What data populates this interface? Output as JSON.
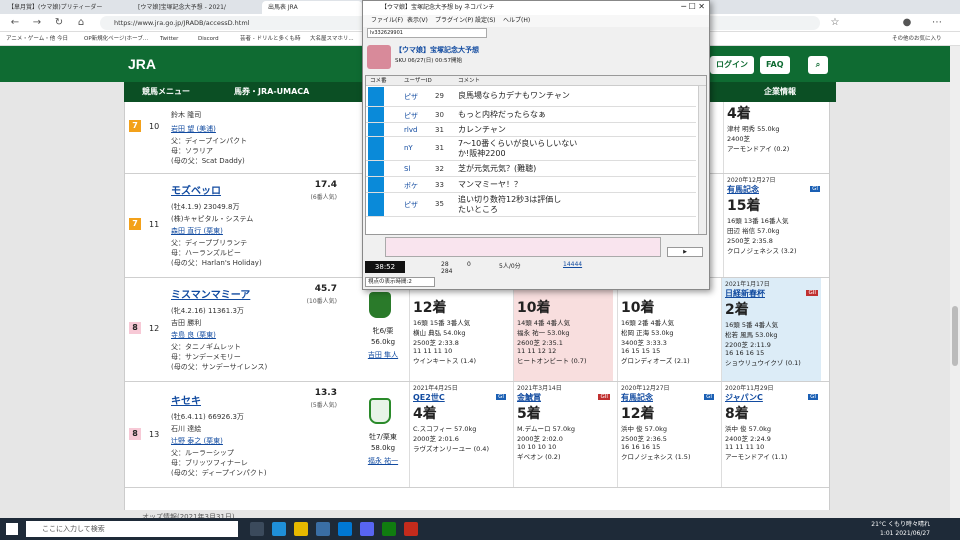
{
  "browser": {
    "tabs": [
      "【皐月賞】(ウマ娘)プリティーダー",
      "[ウマ娘]宝塚記念大予想 - 2021/",
      "出馬表 JRA"
    ],
    "url": "https://www.jra.go.jp/JRADB/accessD.html",
    "bookmarks": [
      "アニメ・ゲーム・他 今日",
      "OP新規化ページ(ホーブ...",
      "Twitter",
      "Discord",
      "芸者 - ドリルと多くも時",
      "大名屋スマホリ...",
      "その他のお気に入り"
    ]
  },
  "jra": {
    "logo": "JRA",
    "login_label": "ログイン",
    "faq_label": "FAQ",
    "nav": [
      "競馬メニュー",
      "馬券・JRA-UMACA",
      "企業情報"
    ]
  },
  "horses": [
    {
      "waku": "7",
      "num": "10",
      "trainer_line": "鈴木 隆司",
      "jockey_line": "岩田 望 (美浦)",
      "father": "父：ディープインパクト",
      "mother": "母：ソラリア",
      "mfather": "(母の父：Scat Daddy)"
    },
    {
      "waku": "7",
      "num": "11",
      "name": "モズベッロ",
      "odds": "17.4",
      "pop": "(6番人気)",
      "info": "(牡4.1.9) 23049.8万",
      "owner": "(株)キャピタル・システム",
      "trainer": "森田 直行 (栗東)",
      "father": "父：ディープブリランテ",
      "mother": "母：ハーランズルビー",
      "mfather": "(母の父：Harlan's Holiday)"
    },
    {
      "waku": "8",
      "num": "12",
      "name": "ミスマンマミーア",
      "odds": "45.7",
      "pop": "(10番人気)",
      "info": "(牝4.2.16) 11361.3万",
      "owner": "吉田 勝利",
      "trainer": "寺島 良 (栗東)",
      "father": "父：タニノギムレット",
      "mother": "母：サンデーメモリー",
      "mfather": "(母の父：サンデーサイレンス)",
      "jockey_weight": "牝6/栗",
      "weight": "56.0kg",
      "jockey": "吉田 隼人"
    },
    {
      "waku": "8",
      "num": "13",
      "name": "キセキ",
      "odds": "13.3",
      "pop": "(5番人気)",
      "info": "(牡6.4.11) 66926.3万",
      "owner": "石川 達絵",
      "trainer": "辻野 泰之 (栗東)",
      "father": "父：ルーラーシップ",
      "mother": "母：ブリッツフィナーレ",
      "mfather": "(母の父：ディープインパクト)",
      "jockey_weight": "牡7/栗東",
      "weight": "58.0kg",
      "jockey": "福永 祐一"
    }
  ],
  "past_races": {
    "row10": [
      {
        "date": "",
        "name": "",
        "place": "4着",
        "detail1": "津村 明秀",
        "detail2": "2400芝",
        "time": "55.0kg",
        "bottom": "アーモンドアイ (0.2)"
      }
    ],
    "row11": [
      {
        "date": "2020年12月27日",
        "name": "有馬記念",
        "grade": "GI",
        "big": "15着",
        "pop": "16頭 13番 16番人気",
        "jockey": "田辺 裕信",
        "weight": "57.0kg",
        "dist": "2500芝",
        "time": "2:35.8",
        "bottom": "クロノジェネシス (3.2)"
      }
    ],
    "row12": [
      {
        "date": "",
        "name": "",
        "big": "12着",
        "pop": "16頭 15番 3番人気",
        "jockey": "横山 典弘",
        "weight": "54.0kg",
        "dist": "2500芝",
        "time": "2:33.8",
        "bottom": "ウインキートス (1.4)",
        "corners": "11 11 11 10"
      },
      {
        "date": "",
        "name": "",
        "big": "10着",
        "pop": "14頭 4番 4番人気",
        "jockey": "福永 祐一",
        "weight": "53.0kg",
        "dist": "2600芝",
        "time": "2:35.1",
        "bottom": "ヒートオンビート (0.7)",
        "corners": "11 11 12 12"
      },
      {
        "date": "",
        "name": "",
        "big": "10着",
        "pop": "16頭 2番 4番人気",
        "jockey": "松岡 正海",
        "weight": "53.0kg",
        "dist": "3400芝",
        "time": "3:33.3",
        "bottom": "グロンディオーズ (2.1)",
        "corners": "16 15 15 15"
      },
      {
        "date": "2021年1月17日",
        "name": "日経新春杯",
        "grade": "GII",
        "big": "2着",
        "pop": "16頭 5番 4番人気",
        "jockey": "松若 風馬",
        "weight": "53.0kg",
        "dist": "2200芝",
        "time": "2:11.9",
        "bottom": "ショウリュウイクゾ (0.1)",
        "corners": "16 16 16 15"
      }
    ],
    "row13": [
      {
        "date": "2021年4月25日",
        "name": "QE2世C",
        "grade": "GI",
        "big": "4着",
        "pop": "",
        "jockey": "C.スコフィー",
        "weight": "57.0kg",
        "dist": "2000芝",
        "time": "2:01.6",
        "bottom": "ラヴズオンリーユー (0.4)",
        "corners": ""
      },
      {
        "date": "2021年3月14日",
        "name": "金鯱賞",
        "grade": "GII",
        "big": "5着",
        "pop": "",
        "jockey": "M.デムーロ",
        "weight": "57.0kg",
        "dist": "2000芝",
        "time": "2:02.0",
        "bottom": "ギベオン (0.2)",
        "corners": "10 10 10 10"
      },
      {
        "date": "2020年12月27日",
        "name": "有馬記念",
        "grade": "GI",
        "big": "12着",
        "pop": "",
        "jockey": "浜中 俊",
        "weight": "57.0kg",
        "dist": "2500芝",
        "time": "2:36.5",
        "bottom": "クロノジェネシス (1.5)",
        "corners": "16 16 16 15"
      },
      {
        "date": "2020年11月29日",
        "name": "ジャパンC",
        "grade": "GI",
        "big": "8着",
        "pop": "",
        "jockey": "浜中 俊",
        "weight": "57.0kg",
        "dist": "2400芝",
        "time": "2:24.9",
        "bottom": "アーモンドアイ (1.1)",
        "corners": "11 11 11 10"
      }
    ]
  },
  "app": {
    "title": "【ウマ娘】宝塚記念大予想 by ネコパンチ",
    "menu": [
      "ファイル(F)",
      "表示(V)",
      "プラグイン(P)",
      "設定(S)",
      "ヘルプ(H)"
    ],
    "url_box": "lv332629901",
    "broadcast_title": "【ウマ娘】宝塚記念大予想",
    "broadcast_sub": "SKU 06/27(日) 00:57開始",
    "headers": [
      "コメ番",
      "ユーザーID",
      "コメント"
    ],
    "comments": [
      {
        "user": "ピザ",
        "no": "29",
        "text": "良馬場ならカデナもワンチャン"
      },
      {
        "user": "ピザ",
        "no": "30",
        "text": "もっと内枠だったらなぁ"
      },
      {
        "user": "rlvd",
        "no": "31",
        "text": "カレンチャン"
      },
      {
        "user": "nY",
        "no": "31",
        "text": "7〜10番くらいが良いらしいないか!阪神2200"
      },
      {
        "user": "Sl",
        "no": "32",
        "text": "芝が元気元気？(難聴)"
      },
      {
        "user": "ポケ",
        "no": "33",
        "text": "マンマミーヤ！？"
      },
      {
        "user": "ピザ",
        "no": "35",
        "text": "追い切り数符12秒3は評価したいところ"
      }
    ],
    "timer": "38:52",
    "stat1": "28",
    "stat2": "284",
    "stat3": "0",
    "stat4": "5人/0分",
    "stat5": "14444",
    "select": "視点の表示時間:2"
  },
  "taskbar": {
    "search": "ここに入力して検索",
    "weather": "21°C くもり時々晴れ",
    "time": "1:01",
    "date": "2021/06/27"
  },
  "bottom_text": "オッズ情報(2021年3月31日)"
}
